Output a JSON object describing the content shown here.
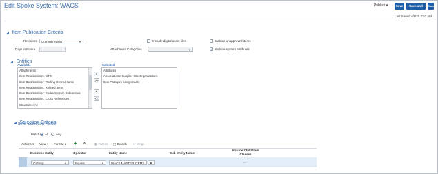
{
  "page": {
    "title": "Edit Spoke System: WACS",
    "publish_label": "Publish",
    "buttons": {
      "save": "Save",
      "save_close": "Save and Close",
      "cancel": "Cancel"
    },
    "last_saved": "Last Saved   4/9/20 2:57 AM"
  },
  "publication": {
    "section_title": "Item Publication Criteria",
    "revisions_label": "Revisions",
    "revisions_value": "Current revision",
    "days_in_future_label": "Days in Future",
    "days_in_future_value": "",
    "attachment_categories_label": "Attachment Categories",
    "attachment_categories_value": "",
    "include_digital_assets_label": "Include digital asset files",
    "include_digital_assets_checked": false,
    "include_unapproved_label": "Include unapproved items",
    "include_unapproved_checked": false,
    "include_system_attributes_label": "Include system attributes",
    "include_system_attributes_checked": true
  },
  "entities": {
    "section_title": "Entities",
    "available_label": "Available",
    "selected_label": "Selected",
    "available": [
      "Attachments",
      "Item Relationships: GTIN",
      "Item Relationships: Trading Partner Items",
      "Item Relationships: Related Items",
      "Item Relationships: Spoke System References",
      "Item Relationships: Cross References",
      "Structures: All"
    ],
    "selected": [
      "Attributes",
      "Associations: Supplier Site Organizations",
      "Item Category Assignments"
    ],
    "move_buttons": [
      ">",
      ">>",
      "<",
      "<<"
    ]
  },
  "selection": {
    "section_title": "Selection Criteria",
    "rules_title": "Item Selection Rules",
    "match_label": "Match",
    "match_all": "All",
    "match_any": "Any",
    "match_value": "All",
    "toolbar": {
      "actions": "Actions",
      "view": "View",
      "format": "Format",
      "add": "+",
      "delete": "✕",
      "freeze": "Freeze",
      "detach": "Detach",
      "wrap": "Wrap"
    },
    "columns": [
      "Business Entity",
      "Operator",
      "Entity Name",
      "Sub-Entity Name",
      "Include Child Item Classes"
    ],
    "row": {
      "business_entity": "Catalog",
      "operator": "Equals",
      "entity_name": "WACS MASTER ITEMS",
      "sub_entity_name": "",
      "include_child": "..."
    }
  },
  "colors": {
    "accent": "#3a6fb0",
    "button": "#1f5fa8",
    "row_highlight": "#e4eef8"
  }
}
